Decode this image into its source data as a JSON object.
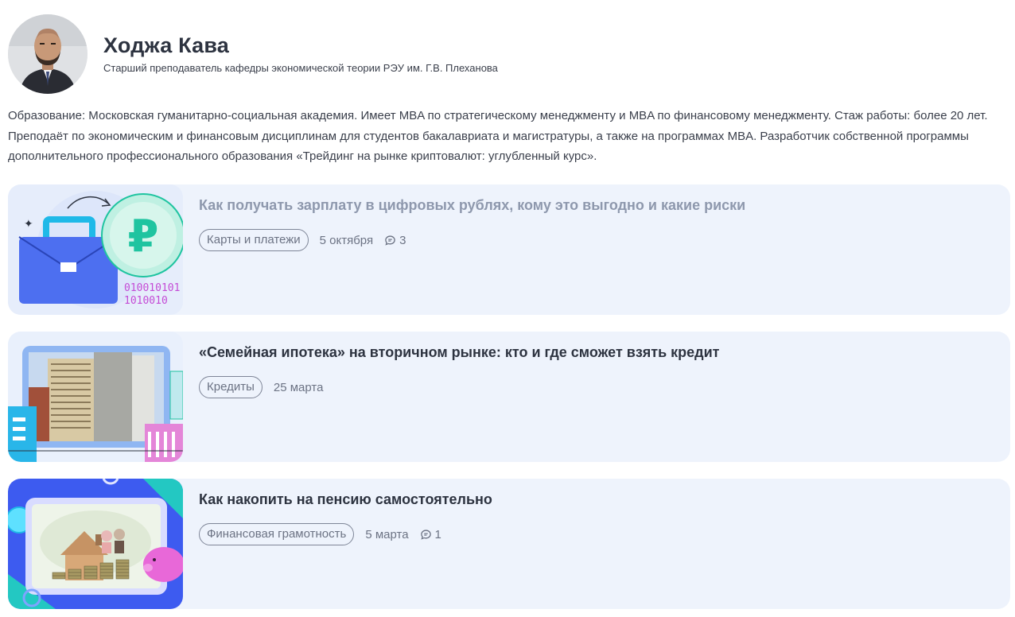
{
  "author": {
    "name": "Ходжа Кава",
    "role": "Старший преподаватель кафедры экономической теории РЭУ им. Г.В. Плеханова",
    "bio": "Образование: Московская гуманитарно-социальная академия. Имеет MBA по стратегическому менеджменту и MBA по финансовому менеджменту. Стаж работы: более 20 лет. Преподаёт по экономическим и финансовым дисциплинам для студентов бакалавриата и магистратуры, а также на программах MBA. Разработчик собственной программы дополнительного профессионального образования «Трейдинг на рынке криптовалют: углубленный курс»."
  },
  "articles": [
    {
      "title": "Как получать зарплату в цифровых рублях, кому это выгодно и какие риски",
      "tag": "Карты и платежи",
      "date": "5 октября",
      "comments": "3",
      "image_text_1": "010010101",
      "image_text_2": "1010010"
    },
    {
      "title": "«Семейная ипотека» на вторичном рынке: кто и где сможет взять кредит",
      "tag": "Кредиты",
      "date": "25 марта"
    },
    {
      "title": "Как накопить на пенсию самостоятельно",
      "tag": "Финансовая грамотность",
      "date": "5 марта",
      "comments": "1"
    }
  ],
  "colors": {
    "card_bg": "#eef3fc",
    "title": "#2d3340",
    "title_visited": "#8e98ad",
    "ruble_green": "#1fc4a0",
    "briefcase_blue": "#4d6ff0"
  },
  "icons": {
    "comment": "comment-icon"
  }
}
